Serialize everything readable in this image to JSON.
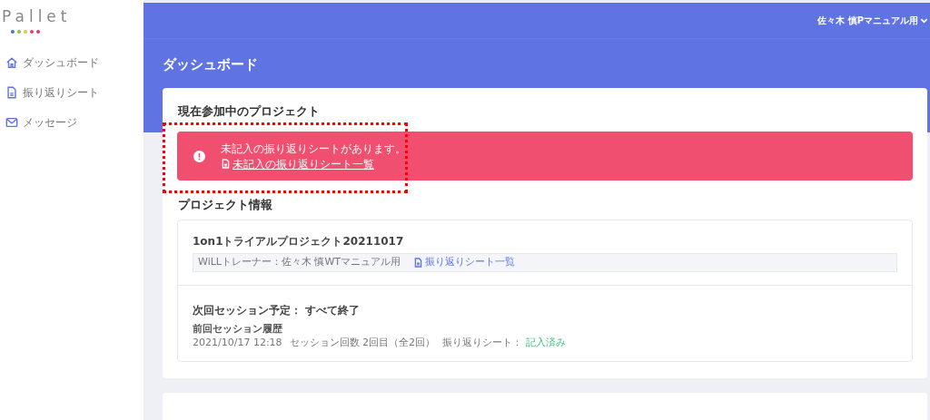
{
  "logo": {
    "text": "Pallet",
    "dots": [
      {
        "color": "#4a6fd6"
      },
      {
        "color": "#8bc34a"
      },
      {
        "color": "#f5c033"
      },
      {
        "color": "#ef3b6a"
      },
      {
        "color": "#e0307e"
      }
    ]
  },
  "sidebar": {
    "items": [
      {
        "kind": "home",
        "label": "ダッシュボード"
      },
      {
        "kind": "sheet",
        "label": "振り返りシート"
      },
      {
        "kind": "mail",
        "label": "メッセージ"
      }
    ]
  },
  "header": {
    "user": "佐々木 慎Pマニュアル用"
  },
  "page_title": "ダッシュボード",
  "current_projects": {
    "title": "現在参加中のプロジェクト",
    "alert": {
      "message": "未記入の振り返りシートがあります。",
      "link": "未記入の振り返りシート一覧"
    },
    "highlighted": true
  },
  "project_info": {
    "title": "プロジェクト情報",
    "project_name": "1on1トライアルプロジェクト20211017",
    "trainer": "WiLLトレーナー：佐々木 慎WTマニュアル用",
    "sheet_link": "振り返りシート一覧",
    "next_session": "次回セッション予定： すべて終了",
    "history_title": "前回セッション履歴",
    "history": {
      "datetime": "2021/10/17 12:18",
      "count": "セッション回数 2回目（全2回）",
      "sheet_label": "振り返りシート：",
      "sheet_status": "記入済み"
    }
  }
}
